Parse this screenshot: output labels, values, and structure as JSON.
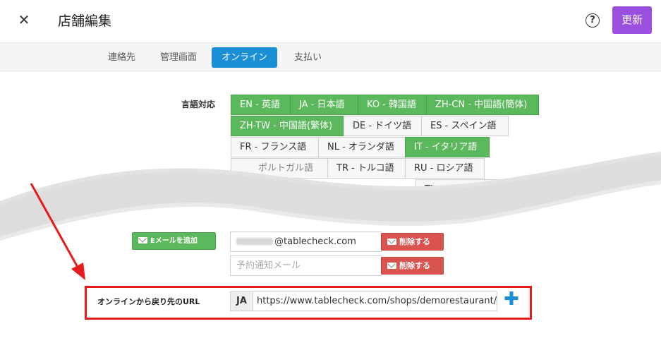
{
  "header": {
    "close_glyph": "✕",
    "title": "店舗編集",
    "help_glyph": "?",
    "update_label": "更新"
  },
  "tabs": [
    {
      "label": "連絡先",
      "active": false
    },
    {
      "label": "管理画面",
      "active": false
    },
    {
      "label": "オンライン",
      "active": true
    },
    {
      "label": "支払い",
      "active": false
    }
  ],
  "languages": {
    "label": "言語対応",
    "chips": [
      {
        "label": "EN - 英語",
        "selected": true
      },
      {
        "label": "JA - 日本語",
        "selected": true
      },
      {
        "label": "KO - 韓国語",
        "selected": true
      },
      {
        "label": "ZH-CN - 中国語(簡体)",
        "selected": true
      },
      {
        "label": "ZH-TW - 中国語(繁体)",
        "selected": true
      },
      {
        "label": "DE - ドイツ語",
        "selected": false
      },
      {
        "label": "ES - スペイン語",
        "selected": false
      },
      {
        "label": "FR - フランス語",
        "selected": false
      },
      {
        "label": "NL - オランダ語",
        "selected": false
      },
      {
        "label": "IT - イタリア語",
        "selected": true
      },
      {
        "label": "TR - トルコ語",
        "selected": false
      },
      {
        "label": "RU - ロシア語",
        "selected": false
      },
      {
        "label": "TL - フィリピン語",
        "selected": false
      }
    ]
  },
  "email": {
    "add_label": "Eメールを追加",
    "first_value_suffix": "@tablecheck.com",
    "second_placeholder": "予約通知メール",
    "delete_label": "削除する"
  },
  "return_url": {
    "label": "オンラインから戻り先のURL",
    "lang_code": "JA",
    "value": "https://www.tablecheck.com/shops/demorestaurant/",
    "add_glyph": "✚"
  },
  "colors": {
    "accent_purple": "#9b4fe0",
    "tab_active": "#1a8fd6",
    "lang_selected": "#5cb85c",
    "delete_red": "#d9534f",
    "highlight_red": "#e61b1b"
  }
}
